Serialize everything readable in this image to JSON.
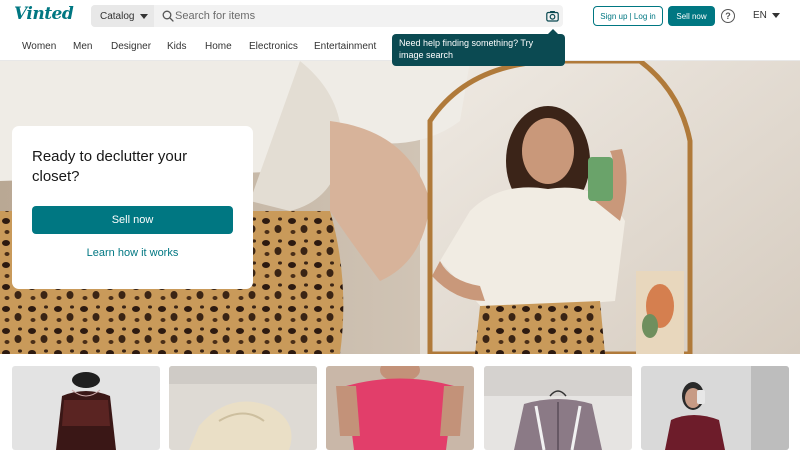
{
  "header": {
    "logo": "Vinted",
    "catalog_label": "Catalog",
    "search_placeholder": "Search for items",
    "login_label": "Sign up | Log in",
    "sell_label": "Sell now",
    "help_glyph": "?",
    "language": "EN",
    "icons": [
      "search-icon",
      "camera-icon",
      "help-icon",
      "chevron-down-icon"
    ]
  },
  "nav": {
    "items": [
      "Women",
      "Men",
      "Designer",
      "Kids",
      "Home",
      "Electronics",
      "Entertainment"
    ]
  },
  "tooltip": {
    "text": "Need help finding something? Try image search"
  },
  "hero": {
    "title": "Ready to declutter your closet?",
    "sell_button": "Sell now",
    "learn_link": "Learn how it works"
  },
  "colors": {
    "brand": "#007782",
    "tooltip_bg": "#0b4a52"
  }
}
